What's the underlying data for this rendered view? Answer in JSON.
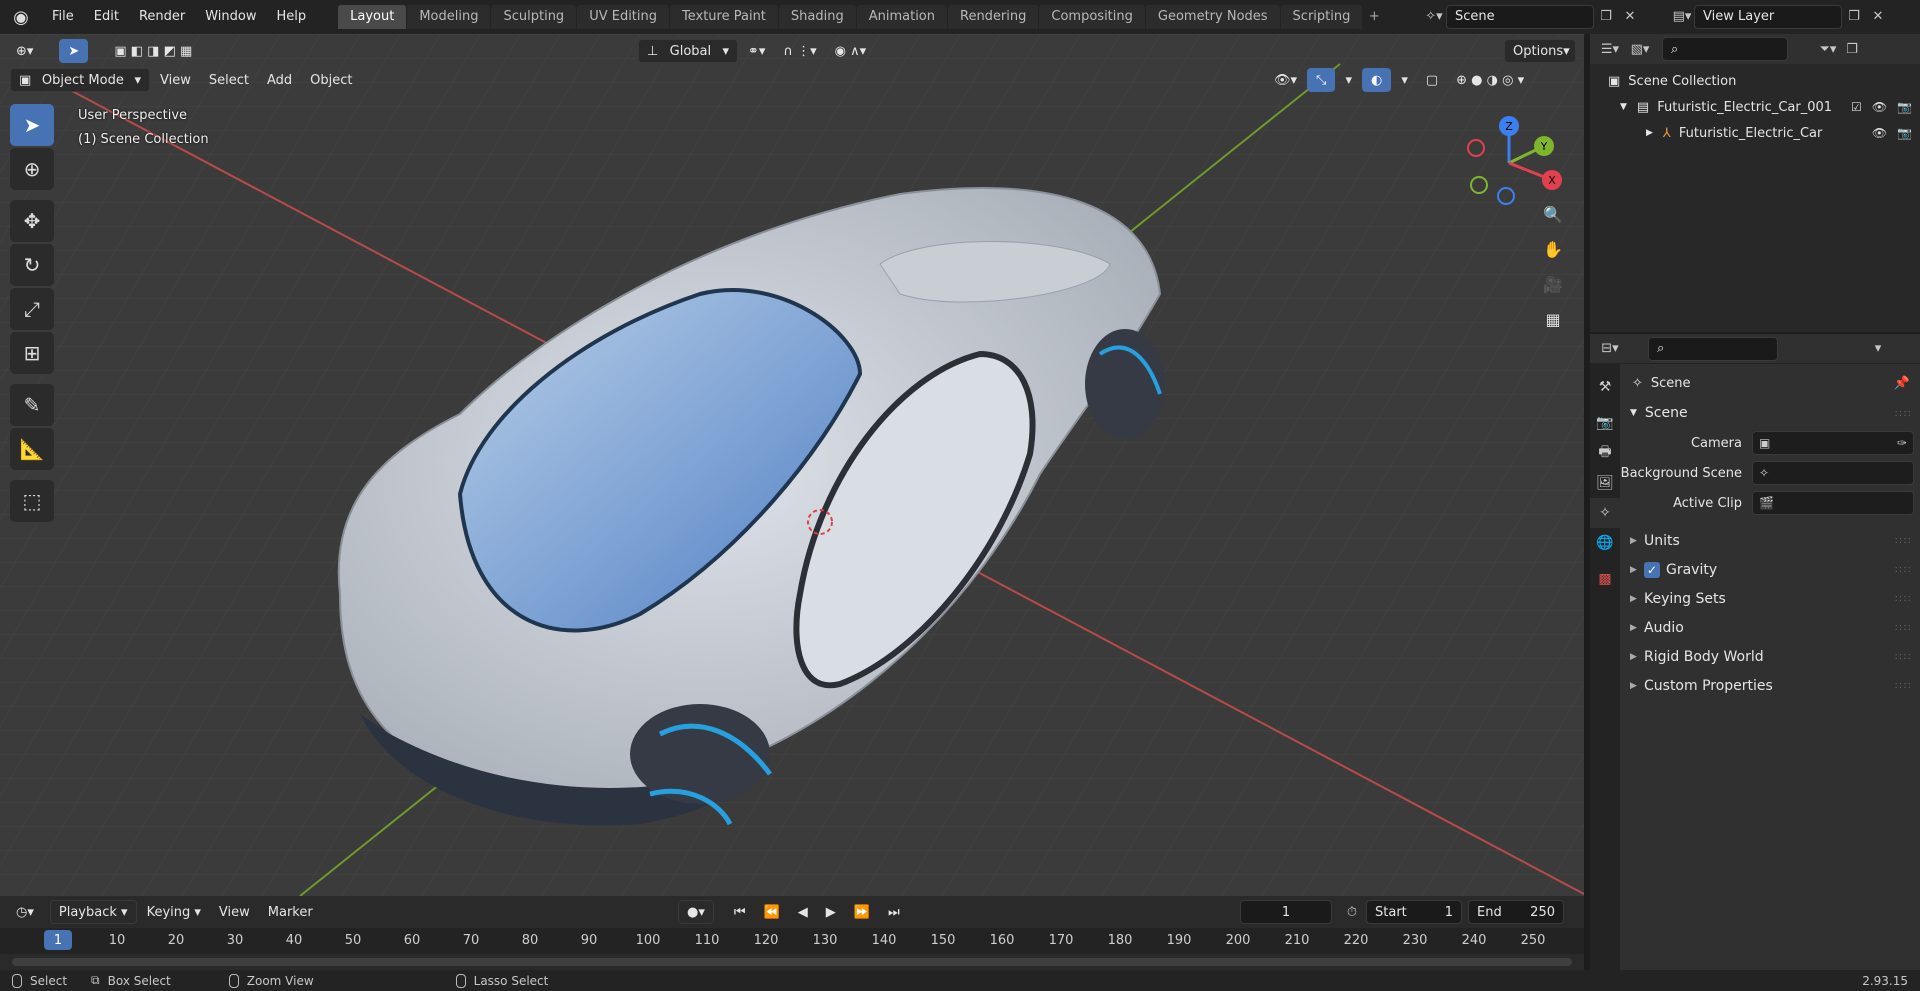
{
  "menu": [
    "File",
    "Edit",
    "Render",
    "Window",
    "Help"
  ],
  "workspaces": [
    "Layout",
    "Modeling",
    "Sculpting",
    "UV Editing",
    "Texture Paint",
    "Shading",
    "Animation",
    "Rendering",
    "Compositing",
    "Geometry Nodes",
    "Scripting"
  ],
  "scene": {
    "name": "Scene"
  },
  "view_layer": {
    "name": "View Layer"
  },
  "viewport": {
    "transform_orientation": "Global",
    "options_label": "Options",
    "mode": "Object Mode",
    "menus": [
      "View",
      "Select",
      "Add",
      "Object"
    ],
    "overlay_title": "User Perspective",
    "overlay_collection": "(1) Scene Collection",
    "gizmo": {
      "x": "X",
      "y": "Y",
      "z": "Z"
    }
  },
  "outliner": {
    "root": "Scene Collection",
    "collection": "Futuristic_Electric_Car_001",
    "object": "Futuristic_Electric_Car"
  },
  "properties": {
    "context": "Scene",
    "section": "Scene",
    "fields": [
      {
        "label": "Camera",
        "value": ""
      },
      {
        "label": "Background Scene",
        "value": ""
      },
      {
        "label": "Active Clip",
        "value": ""
      }
    ],
    "panels": [
      "Units",
      "Gravity",
      "Keying Sets",
      "Audio",
      "Rigid Body World",
      "Custom Properties"
    ],
    "gravity_checked": true
  },
  "timeline": {
    "menus": [
      "Playback",
      "Keying",
      "View",
      "Marker"
    ],
    "current_frame": "1",
    "start_label": "Start",
    "start": "1",
    "end_label": "End",
    "end": "250",
    "ticks": [
      "1",
      "10",
      "20",
      "30",
      "40",
      "50",
      "60",
      "70",
      "80",
      "90",
      "100",
      "110",
      "120",
      "130",
      "140",
      "150",
      "160",
      "170",
      "180",
      "190",
      "200",
      "210",
      "220",
      "230",
      "240",
      "250"
    ]
  },
  "statusbar": {
    "select": "Select",
    "box_select": "Box Select",
    "zoom_view": "Zoom View",
    "lasso_select": "Lasso Select",
    "version": "2.93.15"
  },
  "colors": {
    "accent": "#4772b3",
    "x_axis": "#e2404e",
    "y_axis": "#7fb52d",
    "z_axis": "#3c7ff0"
  }
}
